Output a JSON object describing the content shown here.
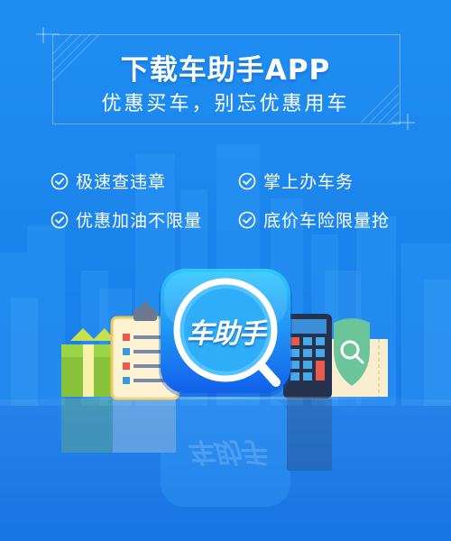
{
  "header": {
    "title": "下载车助手APP",
    "subtitle": "优惠买车，别忘优惠用车"
  },
  "features": [
    {
      "label": "极速查违章",
      "icon": "check-circle-icon"
    },
    {
      "label": "掌上办车务",
      "icon": "check-circle-icon"
    },
    {
      "label": "优惠加油不限量",
      "icon": "check-circle-icon"
    },
    {
      "label": "底价车险限量抢",
      "icon": "check-circle-icon"
    }
  ],
  "app": {
    "name": "车助手",
    "icon": "magnifier-icon"
  },
  "colors": {
    "background": "#1b84ec",
    "app_icon_top": "#28c2ff",
    "app_icon_bottom": "#1166ee",
    "gift_box": "#8cc43c",
    "calculator": "#2b3a57",
    "shield": "#6cc49a"
  }
}
